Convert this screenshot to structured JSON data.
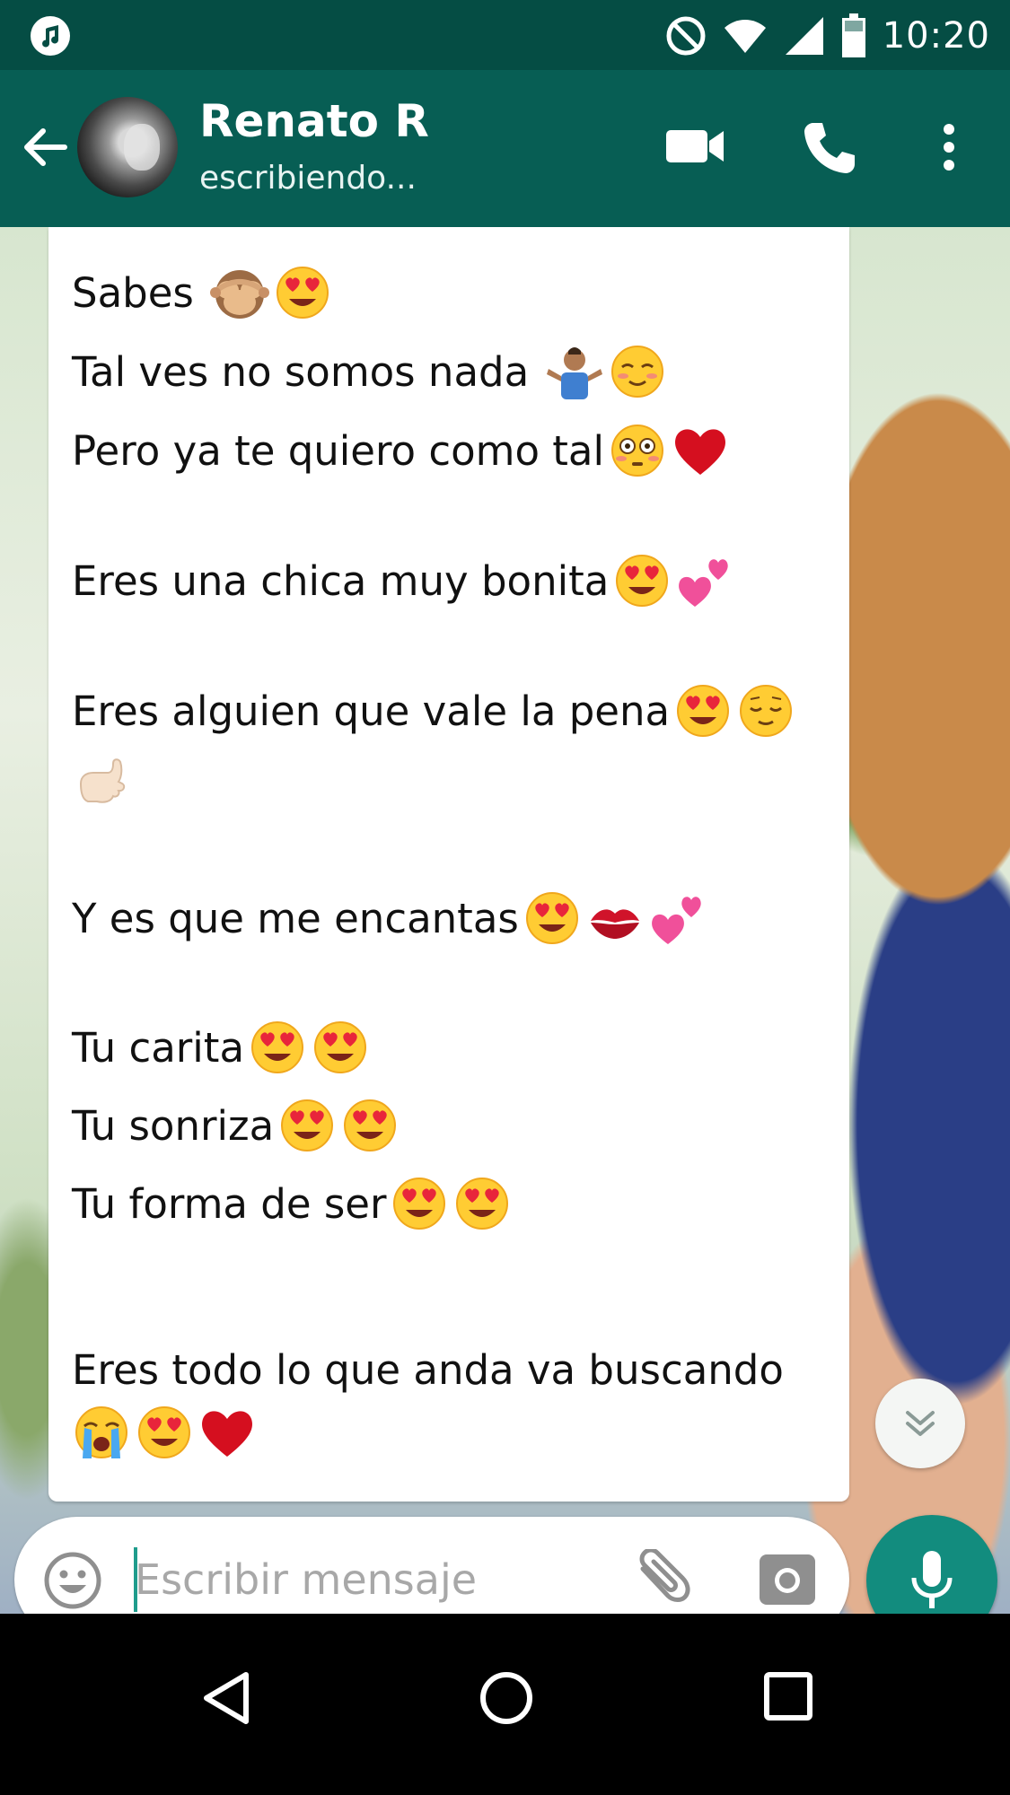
{
  "status_bar": {
    "time": "10:20",
    "icons": [
      "music-note-icon",
      "do-not-disturb-icon",
      "wifi-icon",
      "signal-icon",
      "battery-icon"
    ]
  },
  "header": {
    "contact_name": "Renato R",
    "contact_status": "escribiendo...",
    "icons": [
      "back-arrow-icon",
      "video-call-icon",
      "phone-call-icon",
      "more-options-icon"
    ]
  },
  "message": {
    "lines": [
      {
        "text": "Sabes ",
        "emojis": [
          "see-no-evil-monkey-emoji",
          "heart-eyes-emoji"
        ]
      },
      {
        "text": "Tal ves no somos nada ",
        "emojis": [
          "shrug-emoji",
          "smiling-blush-emoji"
        ]
      },
      {
        "text": "Pero ya te quiero como tal",
        "emojis": [
          "flushed-emoji",
          "red-heart-emoji"
        ]
      },
      {
        "text": "Eres una chica muy bonita",
        "emojis": [
          "heart-eyes-emoji",
          "two-hearts-emoji"
        ]
      },
      {
        "text": "Eres alguien que vale la pena",
        "emojis": [
          "heart-eyes-emoji",
          "relieved-emoji"
        ]
      },
      {
        "text": "",
        "emojis": [
          "call-me-hand-emoji"
        ]
      },
      {
        "text": "Y es que me encantas",
        "emojis": [
          "heart-eyes-emoji",
          "kiss-mark-emoji",
          "two-hearts-emoji"
        ]
      },
      {
        "text": "Tu carita",
        "emojis": [
          "heart-eyes-emoji",
          "heart-eyes-emoji"
        ]
      },
      {
        "text": "Tu sonriza",
        "emojis": [
          "heart-eyes-emoji",
          "heart-eyes-emoji"
        ]
      },
      {
        "text": "Tu forma de ser",
        "emojis": [
          "heart-eyes-emoji",
          "heart-eyes-emoji"
        ]
      },
      {
        "text": "Eres todo lo que anda va buscando",
        "emojis": []
      },
      {
        "text": "",
        "emojis": [
          "loudly-crying-emoji",
          "heart-eyes-emoji",
          "red-heart-emoji"
        ]
      }
    ]
  },
  "composer": {
    "placeholder": "Escribir mensaje",
    "value": "",
    "icons": [
      "emoji-icon",
      "attach-icon",
      "camera-icon",
      "mic-icon",
      "scroll-down-icon"
    ]
  },
  "nav_bar": {
    "icons": [
      "back-nav-icon",
      "home-nav-icon",
      "recents-nav-icon"
    ]
  },
  "colors": {
    "status_bar": "#054d44",
    "header": "#075e54",
    "accent": "#128c7e",
    "bubble": "#ffffff"
  }
}
